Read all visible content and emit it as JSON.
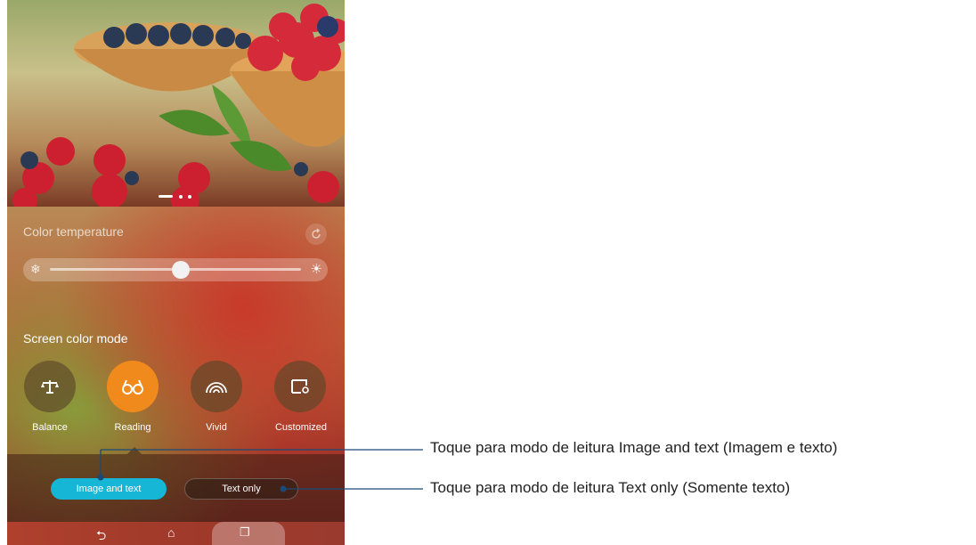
{
  "photo": {
    "description_icon": "fruit-photo"
  },
  "color_temperature": {
    "title": "Color temperature",
    "level": 0.52,
    "icons": {
      "cold": "snowflake-icon",
      "warm": "sun-icon",
      "reset": "refresh-icon"
    }
  },
  "screen_color_mode": {
    "title": "Screen color mode",
    "modes": [
      {
        "label": "Balance",
        "icon": "balance-scale-icon"
      },
      {
        "label": "Reading",
        "icon": "glasses-icon",
        "active": true
      },
      {
        "label": "Vivid",
        "icon": "rainbow-icon"
      },
      {
        "label": "Customized",
        "icon": "custom-screen-icon"
      }
    ]
  },
  "reading_options": {
    "image_and_text": "Image and text",
    "text_only": "Text only"
  },
  "callouts": {
    "image_and_text": "Toque para modo de leitura Image and text (Imagem e texto)",
    "text_only": "Toque para modo de leitura Text only (Somente texto)"
  },
  "colors": {
    "accent": "#f08a1c",
    "pill_active": "#16b6d6",
    "callout_line": "#1a4a7a"
  }
}
